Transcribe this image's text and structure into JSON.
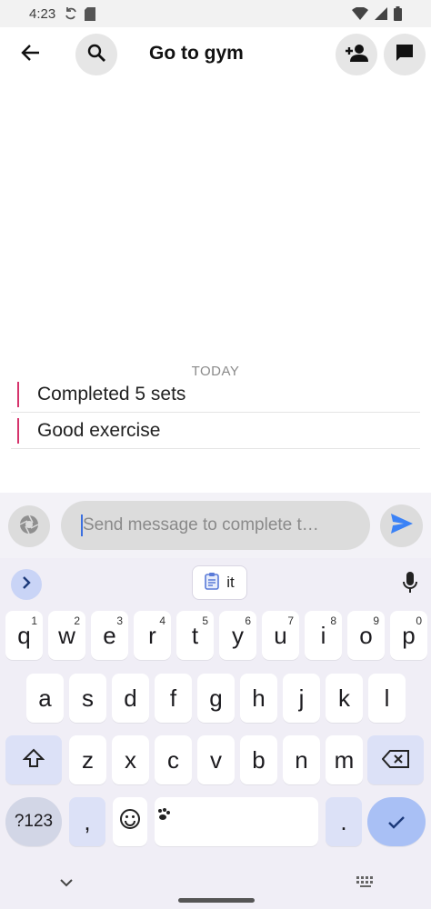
{
  "status_bar": {
    "time": "4:23",
    "icons": [
      "sync-icon",
      "sd-card-icon",
      "wifi-icon",
      "signal-icon",
      "battery-icon"
    ]
  },
  "app_bar": {
    "title": "Go to gym",
    "back_icon": "arrow-back-icon",
    "search_icon": "search-icon",
    "add_person_icon": "person-add-icon",
    "chat_icon": "chat-bubble-icon"
  },
  "messages": {
    "day_label": "TODAY",
    "items": [
      {
        "text": "Completed 5 sets"
      },
      {
        "text": "Good exercise"
      }
    ],
    "accent_color": "#d6336c"
  },
  "composer": {
    "placeholder": "Send message to complete t…",
    "camera_icon": "camera-aperture-icon",
    "send_icon": "send-icon",
    "send_color": "#3b82f6"
  },
  "keyboard": {
    "suggestion": "it",
    "suggestion_icon": "clipboard-icon",
    "row1": [
      {
        "k": "q",
        "h": "1"
      },
      {
        "k": "w",
        "h": "2"
      },
      {
        "k": "e",
        "h": "3"
      },
      {
        "k": "r",
        "h": "4"
      },
      {
        "k": "t",
        "h": "5"
      },
      {
        "k": "y",
        "h": "6"
      },
      {
        "k": "u",
        "h": "7"
      },
      {
        "k": "i",
        "h": "8"
      },
      {
        "k": "o",
        "h": "9"
      },
      {
        "k": "p",
        "h": "0"
      }
    ],
    "row2": [
      "a",
      "s",
      "d",
      "f",
      "g",
      "h",
      "j",
      "k",
      "l"
    ],
    "row3": [
      "z",
      "x",
      "c",
      "v",
      "b",
      "n",
      "m"
    ],
    "sym_label": "?123",
    "comma": ",",
    "period": ".",
    "accent_color": "#a9c0f5"
  }
}
